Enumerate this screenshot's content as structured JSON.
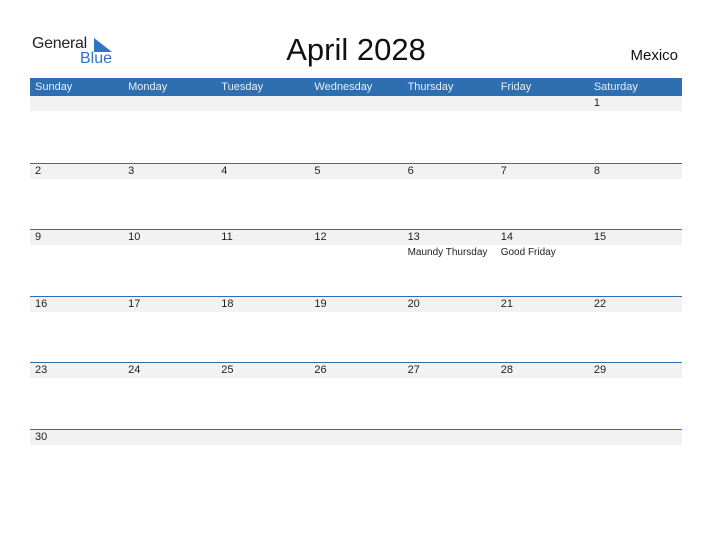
{
  "logo": {
    "line1": "General",
    "line2": "Blue",
    "accent_color": "#2e75c8"
  },
  "header": {
    "title": "April 2028",
    "country": "Mexico"
  },
  "calendar": {
    "header_color": "#2e6fb2",
    "weekdays": [
      "Sunday",
      "Monday",
      "Tuesday",
      "Wednesday",
      "Thursday",
      "Friday",
      "Saturday"
    ],
    "weeks": [
      [
        {
          "day": ""
        },
        {
          "day": ""
        },
        {
          "day": ""
        },
        {
          "day": ""
        },
        {
          "day": ""
        },
        {
          "day": ""
        },
        {
          "day": "1"
        }
      ],
      [
        {
          "day": "2"
        },
        {
          "day": "3"
        },
        {
          "day": "4"
        },
        {
          "day": "5"
        },
        {
          "day": "6"
        },
        {
          "day": "7"
        },
        {
          "day": "8"
        }
      ],
      [
        {
          "day": "9"
        },
        {
          "day": "10"
        },
        {
          "day": "11"
        },
        {
          "day": "12"
        },
        {
          "day": "13",
          "event": "Maundy Thursday"
        },
        {
          "day": "14",
          "event": "Good Friday"
        },
        {
          "day": "15"
        }
      ],
      [
        {
          "day": "16"
        },
        {
          "day": "17"
        },
        {
          "day": "18"
        },
        {
          "day": "19"
        },
        {
          "day": "20"
        },
        {
          "day": "21"
        },
        {
          "day": "22"
        }
      ],
      [
        {
          "day": "23"
        },
        {
          "day": "24"
        },
        {
          "day": "25"
        },
        {
          "day": "26"
        },
        {
          "day": "27"
        },
        {
          "day": "28"
        },
        {
          "day": "29"
        }
      ],
      [
        {
          "day": "30"
        },
        {
          "day": ""
        },
        {
          "day": ""
        },
        {
          "day": ""
        },
        {
          "day": ""
        },
        {
          "day": ""
        },
        {
          "day": ""
        }
      ]
    ]
  }
}
